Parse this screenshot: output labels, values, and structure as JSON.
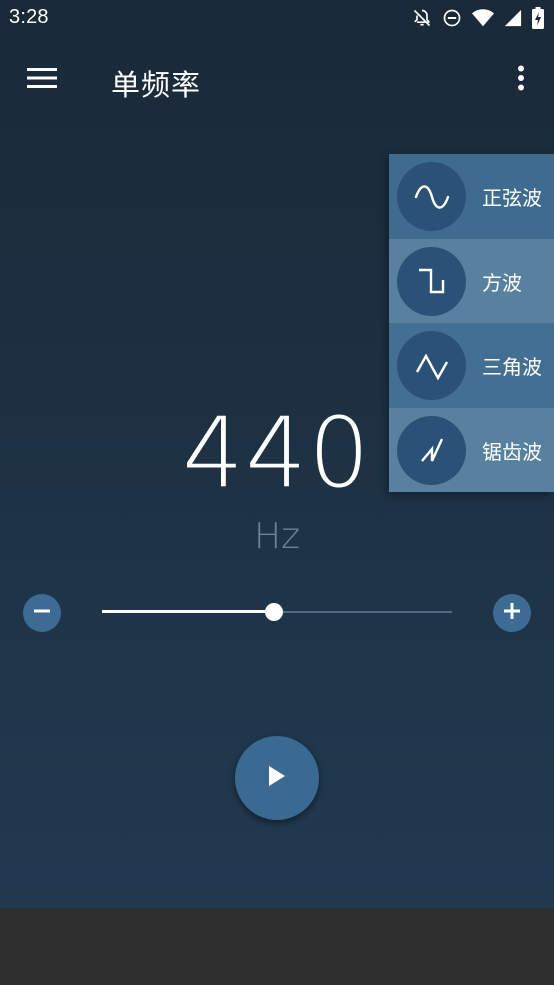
{
  "status_bar": {
    "time": "3:28",
    "icons": [
      "notifications-off-icon",
      "do-not-disturb-icon",
      "wifi-icon",
      "signal-icon",
      "battery-charging-icon"
    ]
  },
  "app_bar": {
    "title": "单频率",
    "menu_icon": "menu-icon",
    "more_icon": "more-vert-icon"
  },
  "frequency": {
    "value": "440",
    "unit": "Hz"
  },
  "slider": {
    "position_fraction": 0.49,
    "decrease_icon": "minus-icon",
    "increase_icon": "plus-icon"
  },
  "play_button": {
    "icon": "play-icon"
  },
  "waveform_menu": {
    "items": [
      {
        "label": "正弦波",
        "icon": "sine-wave-icon"
      },
      {
        "label": "方波",
        "icon": "square-wave-icon"
      },
      {
        "label": "三角波",
        "icon": "triangle-wave-icon"
      },
      {
        "label": "锯齿波",
        "icon": "sawtooth-wave-icon"
      }
    ]
  },
  "colors": {
    "background_top": "#1a2938",
    "background_bottom": "#223b53",
    "accent_button": "#3a6a92",
    "slider_track": "#51697f",
    "unit_text": "#6f8396",
    "bottom_bar": "#2f2f2f"
  }
}
